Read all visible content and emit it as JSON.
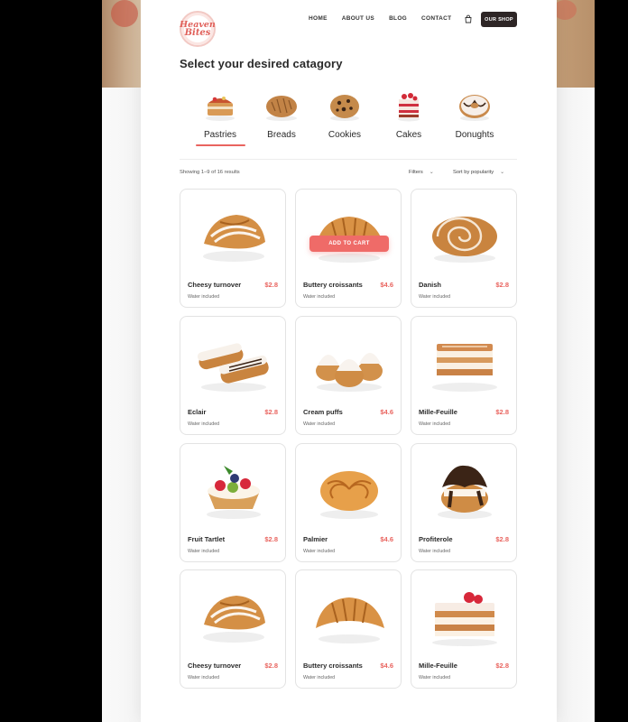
{
  "brand": {
    "logo_line1": "Heaven",
    "logo_line2": "Bites"
  },
  "nav": {
    "links": [
      "HOME",
      "ABOUT US",
      "BLOG",
      "CONTACT"
    ],
    "shop_button": "OUR SHOP"
  },
  "heading": "Select your desired catagory",
  "categories": [
    {
      "label": "Pastries",
      "icon": "pastry-icon",
      "active": true
    },
    {
      "label": "Breads",
      "icon": "bread-icon",
      "active": false
    },
    {
      "label": "Cookies",
      "icon": "cookie-icon",
      "active": false
    },
    {
      "label": "Cakes",
      "icon": "cake-icon",
      "active": false
    },
    {
      "label": "Donughts",
      "icon": "donut-icon",
      "active": false
    }
  ],
  "toolbar": {
    "results": "Showing 1–9 of 16 results",
    "filters": "Filters",
    "sort": "Sort by popularity"
  },
  "add_to_cart": "ADD TO CART",
  "products": [
    {
      "name": "Cheesy turnover",
      "price": "$2.8",
      "note": "Water included",
      "icon": "turnover-icon"
    },
    {
      "name": "Buttery croissants",
      "price": "$4.6",
      "note": "Water included",
      "icon": "croissant-icon"
    },
    {
      "name": "Danish",
      "price": "$2.8",
      "note": "Water included",
      "icon": "danish-icon"
    },
    {
      "name": "Eclair",
      "price": "$2.8",
      "note": "Water included",
      "icon": "eclair-icon"
    },
    {
      "name": "Cream puffs",
      "price": "$4.6",
      "note": "Water included",
      "icon": "cream-puff-icon"
    },
    {
      "name": "Mille-Feuille",
      "price": "$2.8",
      "note": "Water included",
      "icon": "mille-feuille-icon"
    },
    {
      "name": "Fruit Tartlet",
      "price": "$2.8",
      "note": "Water included",
      "icon": "fruit-tartlet-icon"
    },
    {
      "name": "Palmier",
      "price": "$4.6",
      "note": "Water included",
      "icon": "palmier-icon"
    },
    {
      "name": "Profiterole",
      "price": "$2.8",
      "note": "Water included",
      "icon": "profiterole-icon"
    },
    {
      "name": "Cheesy turnover",
      "price": "$2.8",
      "note": "Water included",
      "icon": "turnover-icon"
    },
    {
      "name": "Buttery croissants",
      "price": "$4.6",
      "note": "Water included",
      "icon": "croissant-icon"
    },
    {
      "name": "Mille-Feuille",
      "price": "$2.8",
      "note": "Water included",
      "icon": "mille-feuille-icon"
    }
  ],
  "colors": {
    "accent": "#e9645f",
    "dark": "#2d2525"
  }
}
